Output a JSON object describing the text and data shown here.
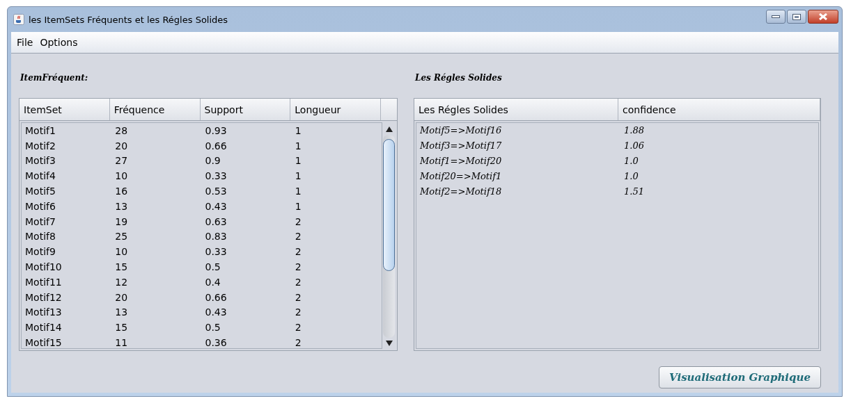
{
  "window": {
    "title": "les ItemSets Fréquents et les Régles Solides"
  },
  "menu": [
    "File",
    "Options"
  ],
  "itemsets": {
    "label": "ItemFréquent:",
    "columns": [
      "ItemSet",
      "Fréquence",
      "Support",
      "Longueur"
    ],
    "rows": [
      [
        "Motif1",
        "28",
        "0.93",
        "1"
      ],
      [
        "Motif2",
        "20",
        "0.66",
        "1"
      ],
      [
        "Motif3",
        "27",
        "0.9",
        "1"
      ],
      [
        "Motif4",
        "10",
        "0.33",
        "1"
      ],
      [
        "Motif5",
        "16",
        "0.53",
        "1"
      ],
      [
        "Motif6",
        "13",
        "0.43",
        "1"
      ],
      [
        "Motif7",
        "19",
        "0.63",
        "2"
      ],
      [
        "Motif8",
        "25",
        "0.83",
        "2"
      ],
      [
        "Motif9",
        "10",
        "0.33",
        "2"
      ],
      [
        "Motif10",
        "15",
        "0.5",
        "2"
      ],
      [
        "Motif11",
        "12",
        "0.4",
        "2"
      ],
      [
        "Motif12",
        "20",
        "0.66",
        "2"
      ],
      [
        "Motif13",
        "13",
        "0.43",
        "2"
      ],
      [
        "Motif14",
        "15",
        "0.5",
        "2"
      ],
      [
        "Motif15",
        "11",
        "0.36",
        "2"
      ]
    ]
  },
  "rules": {
    "label": "Les Régles Solides",
    "columns": [
      "Les Régles Solides",
      "confidence"
    ],
    "rows": [
      [
        "Motif5=>Motif16",
        "1.88"
      ],
      [
        "Motif3=>Motif17",
        "1.06"
      ],
      [
        "Motif1=>Motif20",
        "1.0"
      ],
      [
        "Motif20=>Motif1",
        "1.0"
      ],
      [
        "Motif2=>Motif18",
        "1.51"
      ]
    ]
  },
  "button": "Visualisation Graphique"
}
